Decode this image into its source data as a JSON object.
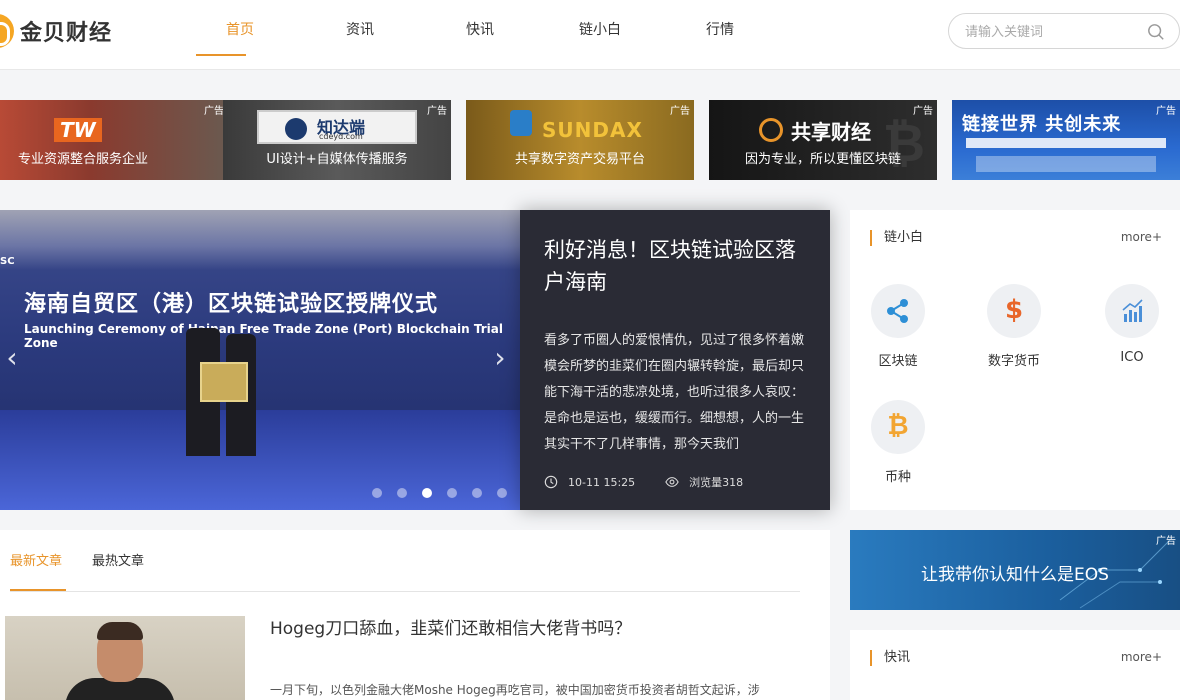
{
  "header": {
    "logo_text": "金贝财经",
    "nav": [
      "首页",
      "资讯",
      "快讯",
      "链小白",
      "行情"
    ],
    "search_placeholder": "请输入关键词"
  },
  "ads": [
    {
      "tag": "广告",
      "caption": "专业资源整合服务企业",
      "logo": "TW"
    },
    {
      "tag": "广告",
      "caption": "UI设计+自媒体传播服务",
      "logo": "知达端",
      "logo_sub": "cdeyd.com"
    },
    {
      "tag": "广告",
      "caption": "共享数字资产交易平台",
      "logo": "SUNDAX"
    },
    {
      "tag": "广告",
      "caption": "因为专业，所以更懂区块链",
      "logo": "共享财经"
    },
    {
      "tag": "广告",
      "caption": "",
      "logo": "链接世界 共创未来"
    }
  ],
  "hero": {
    "banner_title": "海南自贸区（港）区块链试验区授牌仪式",
    "banner_sub": "Launching Ceremony of Hainan Free Trade Zone (Port) Blockchain Trial Zone",
    "badge": "SC",
    "title": "利好消息！区块链试验区落户海南",
    "desc": "看多了币圈人的爱恨情仇，见过了很多怀着嫩模会所梦的韭菜们在圈内辗转斡旋，最后却只能下海干活的悲凉处境，也听过很多人哀叹：是命也是运也，缓缓而行。细想想，人的一生其实干不了几样事情，那今天我们",
    "time": "10-11 15:25",
    "views": "浏览量318",
    "slide_count": 6,
    "active_slide": 3
  },
  "sidebar_chain": {
    "title": "链小白",
    "more": "more+",
    "items": [
      {
        "label": "区块链",
        "icon": "share-nodes-icon"
      },
      {
        "label": "数字货币",
        "icon": "dollar-icon"
      },
      {
        "label": "ICO",
        "icon": "chart-icon"
      },
      {
        "label": "币种",
        "icon": "bitcoin-icon"
      }
    ]
  },
  "eos_ad": {
    "tag": "广告",
    "text": "让我带你认知什么是EOS"
  },
  "sidebar_flash": {
    "title": "快讯",
    "more": "more+"
  },
  "articles": {
    "tabs": [
      "最新文章",
      "最热文章"
    ],
    "items": [
      {
        "title": "Hogeg刀口舔血，韭菜们还敢相信大佬背书吗？",
        "excerpt": "一月下旬，以色列金融大佬Moshe Hogeg再吃官司，被中国加密货币投资者胡哲文起诉，涉"
      }
    ]
  },
  "colors": {
    "accent": "#e8942a",
    "hero_panel": "#2a2b35",
    "page_bg": "#f4f5f7"
  }
}
